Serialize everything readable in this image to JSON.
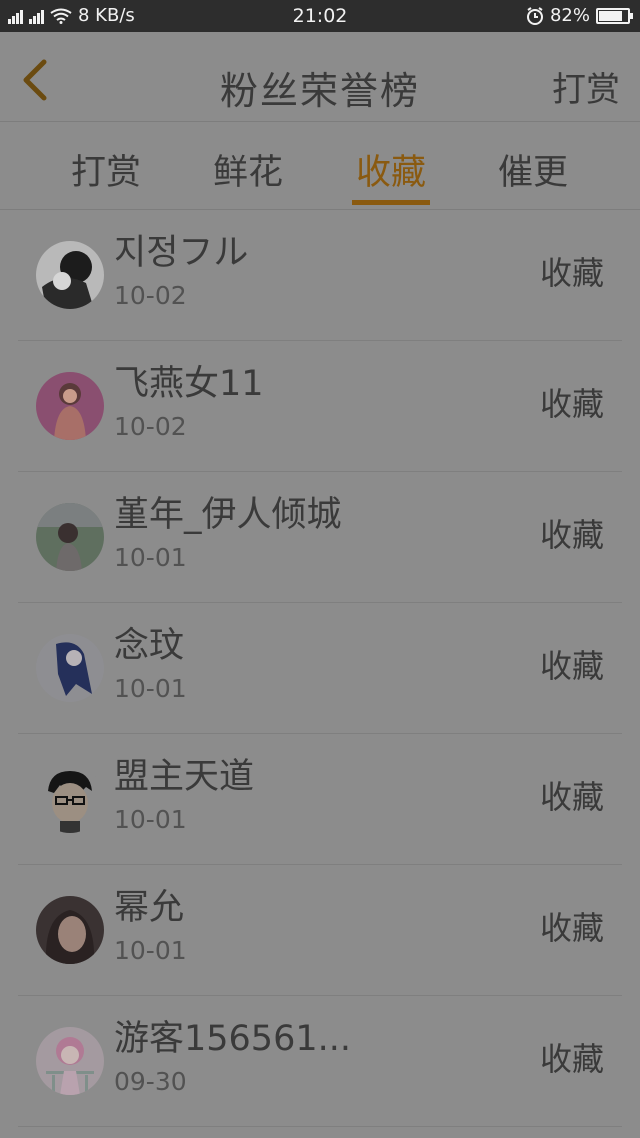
{
  "status_bar": {
    "network_speed": "8 KB/s",
    "time": "21:02",
    "battery": "82%",
    "battery_level": 0.82
  },
  "header": {
    "back_icon": "chevron-left-icon",
    "title": "粉丝荣誉榜",
    "reward_link": "打赏"
  },
  "tabs": [
    {
      "label": "打赏",
      "active": false
    },
    {
      "label": "鲜花",
      "active": false
    },
    {
      "label": "收藏",
      "active": true
    },
    {
      "label": "催更",
      "active": false
    }
  ],
  "colors": {
    "accent": "#8a5a10",
    "overlay_bg": "#8c8c8c",
    "status_bar": "#2d2d2d"
  },
  "fans": [
    {
      "name": "지정フル",
      "date": "10-02",
      "action": "收藏"
    },
    {
      "name": "飞燕女11",
      "date": "10-02",
      "action": "收藏"
    },
    {
      "name": "堇年_伊人倾城",
      "date": "10-01",
      "action": "收藏"
    },
    {
      "name": "念玟",
      "date": "10-01",
      "action": "收藏"
    },
    {
      "name": "盟主天道",
      "date": "10-01",
      "action": "收藏"
    },
    {
      "name": "幂允",
      "date": "10-01",
      "action": "收藏"
    },
    {
      "name": "游客156561...",
      "date": "09-30",
      "action": "收藏"
    }
  ]
}
